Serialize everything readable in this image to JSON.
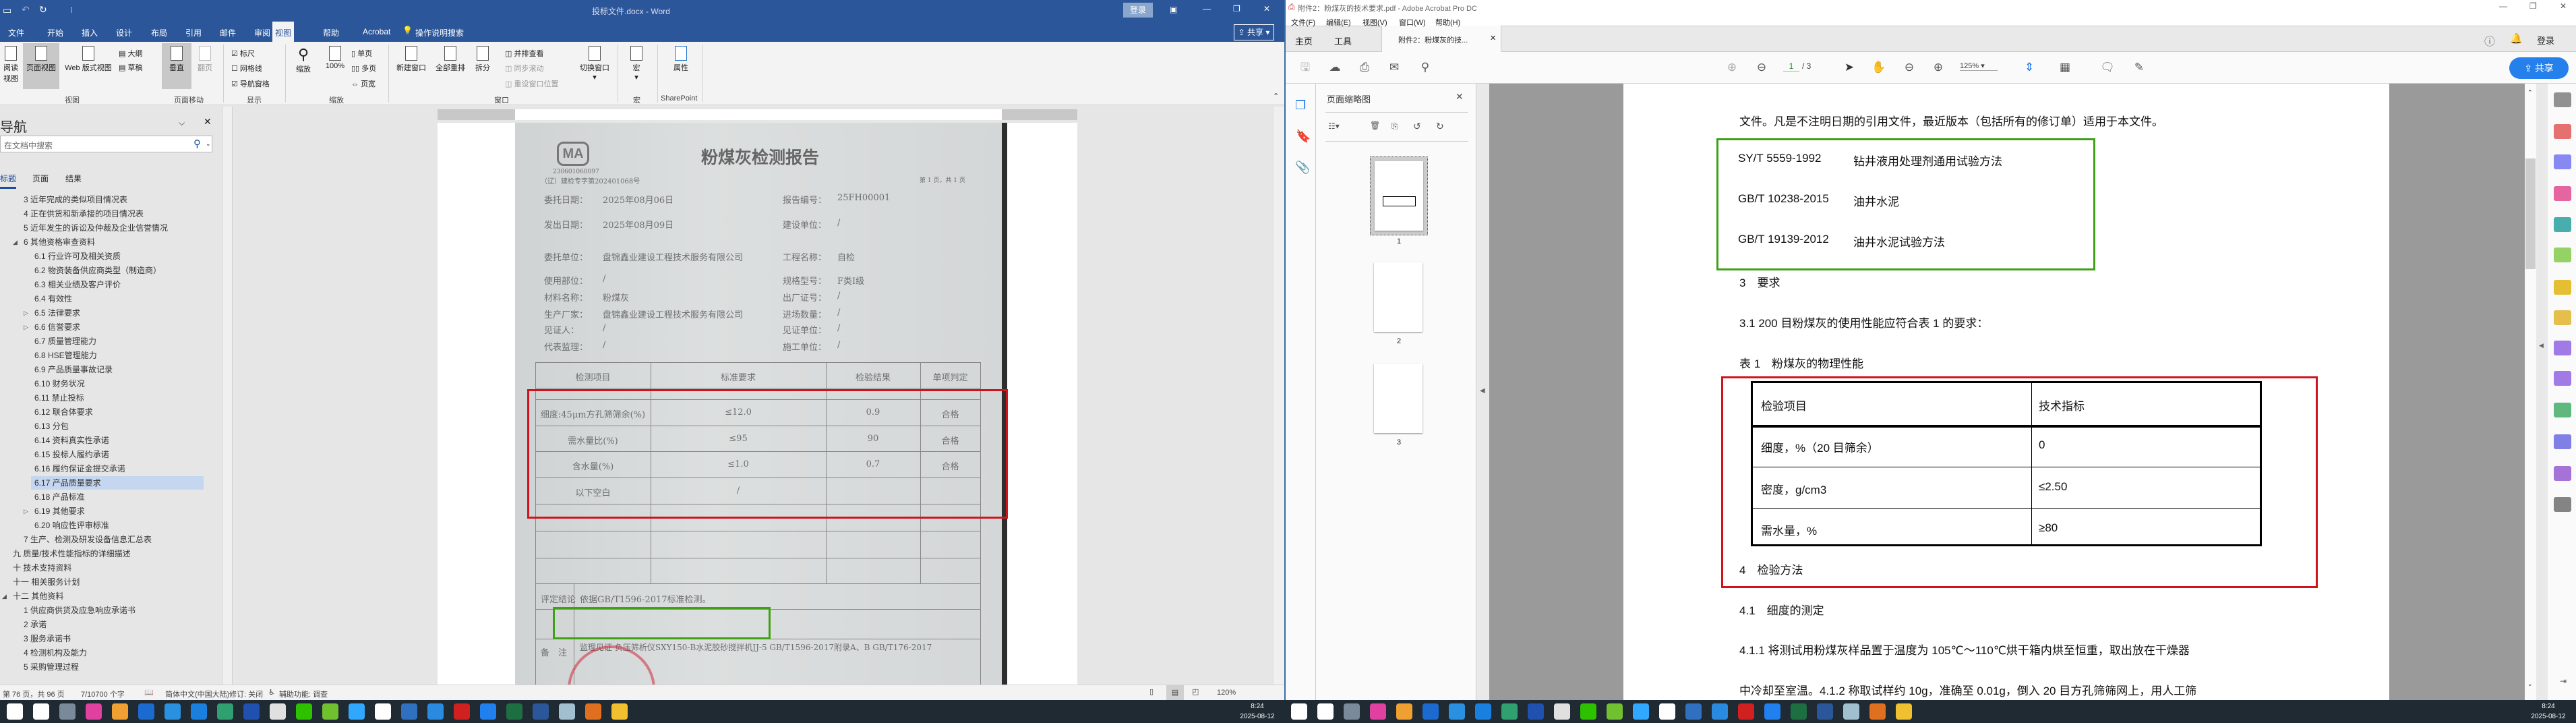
{
  "word": {
    "title": "投标文件.docx - Word",
    "login": "登录",
    "share": "共享",
    "tabs": [
      "文件",
      "开始",
      "插入",
      "设计",
      "布局",
      "引用",
      "邮件",
      "审阅",
      "视图",
      "帮助",
      "Acrobat",
      "操作说明搜索"
    ],
    "active_tab": "视图",
    "ribbon": {
      "read_view": "阅读视图",
      "print_layout": "页面视图",
      "web_layout": "Web 版式视图",
      "outline": "大纲",
      "draft": "草稿",
      "vertical": "垂直",
      "side_to_side": "翻页",
      "ruler": "标尺",
      "gridlines": "网格线",
      "nav_pane": "导航窗格",
      "zoom": "缩放",
      "zoom100": "100%",
      "one_page": "单页",
      "multi_page": "多页",
      "page_width": "页宽",
      "new_window": "新建窗口",
      "arrange_all": "全部重排",
      "split": "拆分",
      "side_by_side": "并排查看",
      "sync_scroll": "同步滚动",
      "reset_window": "重设窗口位置",
      "switch_window": "切换窗口",
      "macros": "宏",
      "properties": "属性",
      "groups": {
        "views": "视图",
        "page_movement": "页面移动",
        "show": "显示",
        "zoom": "缩放",
        "window": "窗口",
        "macros": "宏",
        "sharepoint": "SharePoint"
      }
    },
    "nav": {
      "title": "导航",
      "search_placeholder": "在文档中搜索",
      "tabs": [
        "标题",
        "页面",
        "结果"
      ],
      "items": [
        {
          "label": "3 近年完成的类似项目情况表",
          "level": 1
        },
        {
          "label": "4 正在供货和新承接的项目情况表",
          "level": 1
        },
        {
          "label": "5 近年发生的诉讼及仲裁及企业信誉情况",
          "level": 1
        },
        {
          "label": "6 其他资格审查资料",
          "level": 1,
          "toggle": "expanded"
        },
        {
          "label": "6.1 行业许可及相关资质",
          "level": 2
        },
        {
          "label": "6.2 物资装备供应商类型（制造商）",
          "level": 2
        },
        {
          "label": "6.3 相关业绩及客户评价",
          "level": 2
        },
        {
          "label": "6.4 有效性",
          "level": 2
        },
        {
          "label": "6.5 法律要求",
          "level": 2,
          "toggle": "collapsed"
        },
        {
          "label": "6.6 信誉要求",
          "level": 2,
          "toggle": "collapsed"
        },
        {
          "label": "6.7 质量管理能力",
          "level": 2
        },
        {
          "label": "6.8 HSE管理能力",
          "level": 2
        },
        {
          "label": "6.9 产品质量事故记录",
          "level": 2
        },
        {
          "label": "6.10 财务状况",
          "level": 2
        },
        {
          "label": "6.11 禁止投标",
          "level": 2
        },
        {
          "label": "6.12 联合体要求",
          "level": 2
        },
        {
          "label": "6.13 分包",
          "level": 2
        },
        {
          "label": "6.14 资料真实性承诺",
          "level": 2
        },
        {
          "label": "6.15 投标人履约承诺",
          "level": 2
        },
        {
          "label": "6.16 履约保证金提交承诺",
          "level": 2
        },
        {
          "label": "6.17 产品质量要求",
          "level": 2,
          "selected": true
        },
        {
          "label": "6.18 产品标准",
          "level": 2
        },
        {
          "label": "6.19 其他要求",
          "level": 2,
          "toggle": "collapsed"
        },
        {
          "label": "6.20 响应性评审标准",
          "level": 2
        },
        {
          "label": "7 生产、检测及研发设备信息汇总表",
          "level": 1
        },
        {
          "label": "九 质量/技术性能指标的详细描述",
          "level": 0
        },
        {
          "label": "十 技术支持资料",
          "level": 0
        },
        {
          "label": "十一 相关服务计划",
          "level": 0
        },
        {
          "label": "十二 其他资料",
          "level": 0,
          "toggle": "expanded"
        },
        {
          "label": "1 供应商供货及应急响应承诺书",
          "level": 1
        },
        {
          "label": "2 承诺",
          "level": 1
        },
        {
          "label": "3 服务承诺书",
          "level": 1
        },
        {
          "label": "4 检测机构及能力",
          "level": 1
        },
        {
          "label": "5 采购管理过程",
          "level": 1
        }
      ]
    },
    "report": {
      "title": "粉煤灰检测报告",
      "ma_code": "230601060097",
      "cert_no": "（辽）建检专字第202401068号",
      "page_info": "第 1 页，共 1 页",
      "fields_left": [
        {
          "label": "委托日期：",
          "value": "2025年08月06日"
        },
        {
          "label": "发出日期：",
          "value": "2025年08月09日"
        },
        {
          "label": "委托单位：",
          "value": "盘锦鑫业建设工程技术服务有限公司"
        },
        {
          "label": "使用部位：",
          "value": "/"
        },
        {
          "label": "材料名称：",
          "value": "粉煤灰"
        },
        {
          "label": "生产厂家：",
          "value": "盘锦鑫业建设工程技术服务有限公司"
        },
        {
          "label": "见证人：",
          "value": "/"
        },
        {
          "label": "代表监理：",
          "value": "/"
        }
      ],
      "fields_right": [
        {
          "label": "报告编号：",
          "value": "25FH00001"
        },
        {
          "label": "建设单位：",
          "value": "/"
        },
        {
          "label": "工程名称：",
          "value": "自检"
        },
        {
          "label": "规格型号：",
          "value": "F类Ⅰ级"
        },
        {
          "label": "出厂证号：",
          "value": "/"
        },
        {
          "label": "进场数量：",
          "value": "/"
        },
        {
          "label": "见证单位：",
          "value": "/"
        },
        {
          "label": "施工单位：",
          "value": "/"
        }
      ],
      "table_headers": [
        "检测项目",
        "标准要求",
        "检验结果",
        "单项判定"
      ],
      "rows": [
        [
          "细度:45μm方孔筛筛余(%)",
          "≤12.0",
          "0.9",
          "合格"
        ],
        [
          "需水量比(%)",
          "≤95",
          "90",
          "合格"
        ],
        [
          "含水量(%)",
          "≤1.0",
          "0.7",
          "合格"
        ],
        [
          "以下空白",
          "/",
          "",
          ""
        ]
      ],
      "conclusion_label": "评定结论",
      "conclusion": "依据GB/T1596-2017标准检测。",
      "remark_label": "备　注",
      "remark": "监理见证 负压筛析仪SXY150-B水泥胶砂搅拌机JJ-5 GB/T1596-2017附录A、B GB/T176-2017"
    },
    "status": {
      "page": "第 76 页，共 96 页",
      "words": "7/10700 个字",
      "language": "简体中文(中国大陆)",
      "track": "修订: 关闭",
      "accessibility": "辅助功能: 调查",
      "zoom": "120%"
    }
  },
  "acrobat": {
    "title": "附件2：粉煤灰的技术要求.pdf - Adobe Acrobat Pro DC",
    "menu": [
      "文件(F)",
      "编辑(E)",
      "视图(V)",
      "窗口(W)",
      "帮助(H)"
    ],
    "tabs": {
      "home": "主页",
      "tools": "工具",
      "doc": "附件2：粉煤灰的技..."
    },
    "login": "登录",
    "share": "共享",
    "page_current": "1",
    "page_total": "/ 3",
    "zoom": "125%",
    "thumb_panel_title": "页面缩略图",
    "thumb_labels": [
      "1",
      "2",
      "3"
    ],
    "doc": {
      "line1": "文件。凡是不注明日期的引用文件，最近版本（包括所有的修订单）适用于本文件。",
      "refs": [
        {
          "code": "SY/T 5559-1992",
          "name": "钻井液用处理剂通用试验方法"
        },
        {
          "code": "GB/T 10238-2015",
          "name": "油井水泥"
        },
        {
          "code": "GB/T 19139-2012",
          "name": "油井水泥试验方法"
        }
      ],
      "h3": "3　要求",
      "p31": "3.1 200 目粉煤灰的使用性能应符合表 1 的要求：",
      "table_caption": "表 1　粉煤灰的物理性能",
      "table_headers": [
        "检验项目",
        "技术指标"
      ],
      "table_rows": [
        [
          "细度，%（20 目筛余）",
          "0"
        ],
        [
          "密度，g/cm3",
          "≤2.50"
        ],
        [
          "需水量，%",
          "≥80"
        ]
      ],
      "h4": "4　检验方法",
      "h41": "4.1　细度的测定",
      "p411": "4.1.1 将测试用粉煤灰样品置于温度为 105℃～110℃烘干箱内烘至恒重，取出放在干燥器",
      "p412": "中冷却至室温。4.1.2 称取试样约 10g，准确至 0.01g，倒入 20 目方孔筛筛网上，用人工筛"
    }
  },
  "taskbar": {
    "time": "8:24",
    "date": "2025-08-12",
    "icons": [
      {
        "name": "windows-start",
        "color": "#ffffff"
      },
      {
        "name": "search",
        "color": "#ffffff"
      },
      {
        "name": "calculator",
        "color": "#7a8a9a"
      },
      {
        "name": "color-wheel-app",
        "color": "#e040a0"
      },
      {
        "name": "camera-app",
        "color": "#f0a030"
      },
      {
        "name": "dots-app",
        "color": "#1a6ad0"
      },
      {
        "name": "blue-white-app",
        "color": "#2a90e0"
      },
      {
        "name": "circle-app",
        "color": "#1a80e0"
      },
      {
        "name": "swirl-app",
        "color": "#30a070"
      },
      {
        "name": "ns-app",
        "color": "#2050b0"
      },
      {
        "name": "f-app",
        "color": "#e0e0e0"
      },
      {
        "name": "wechat",
        "color": "#2dc100"
      },
      {
        "name": "pen-app",
        "color": "#70c030"
      },
      {
        "name": "photoshop",
        "color": "#31a8ff"
      },
      {
        "name": "qq",
        "color": "#ffffff"
      },
      {
        "name": "xin-app",
        "color": "#3070c0"
      },
      {
        "name": "q-search-app",
        "color": "#2a8ae0"
      },
      {
        "name": "acrobat",
        "color": "#d02020"
      },
      {
        "name": "browser",
        "color": "#2080f0"
      },
      {
        "name": "excel",
        "color": "#1d6f42"
      },
      {
        "name": "word",
        "color": "#2b579a"
      },
      {
        "name": "notepad",
        "color": "#a0c0d0"
      },
      {
        "name": "j-app",
        "color": "#e07020"
      },
      {
        "name": "file-explorer",
        "color": "#f0c030"
      }
    ]
  },
  "colors": {
    "word_blue": "#2b579a",
    "acro_blue": "#2680eb",
    "highlight_red": "#d0141e",
    "highlight_green": "#3fa016"
  }
}
